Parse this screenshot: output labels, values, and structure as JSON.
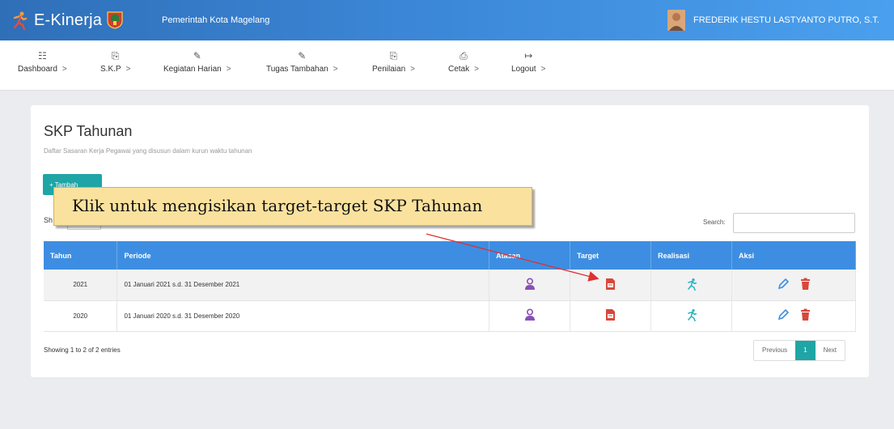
{
  "header": {
    "brand": "E-Kinerja",
    "organization": "Pemerintah Kota Magelang",
    "user_name": "FREDERIK HESTU LASTYANTO PUTRO, S.T."
  },
  "nav": [
    {
      "label": "Dashboard",
      "icon": "dashboard-icon"
    },
    {
      "label": "S.K.P",
      "icon": "file-icon"
    },
    {
      "label": "Kegiatan Harian",
      "icon": "edit-icon"
    },
    {
      "label": "Tugas Tambahan",
      "icon": "edit-icon"
    },
    {
      "label": "Penilaian",
      "icon": "file-icon"
    },
    {
      "label": "Cetak",
      "icon": "print-icon"
    },
    {
      "label": "Logout",
      "icon": "logout-icon"
    }
  ],
  "page": {
    "title": "SKP Tahunan",
    "subtitle": "Daftar Sasaran Kerja Pegawai yang disusun dalam kurun waktu tahunan",
    "add_button": "+ Tambah",
    "show_label": "Sh",
    "search_label": "Search:"
  },
  "table": {
    "headers": [
      "Tahun",
      "Periode",
      "Atasan",
      "Target",
      "Realisasi",
      "Aksi"
    ],
    "rows": [
      {
        "year": "2021",
        "period": "01 Januari 2021  s.d.  31 Desember 2021"
      },
      {
        "year": "2020",
        "period": "01 Januari 2020  s.d.  31 Desember 2020"
      }
    ]
  },
  "footer": {
    "showing": "Showing 1 to 2 of 2 entries",
    "prev": "Previous",
    "page": "1",
    "next": "Next"
  },
  "annotation": {
    "text": "Klik untuk mengisikan target-target SKP Tahunan"
  },
  "colors": {
    "header_start": "#2f6fb8",
    "header_end": "#4aa0ee",
    "table_header": "#3d8ee2",
    "primary_teal": "#1fa5a5",
    "atasan_icon": "#8a4fb5",
    "target_icon": "#d9473a",
    "realisasi_icon": "#2bb3c0",
    "edit_icon": "#3d8ee2",
    "delete_icon": "#d9473a",
    "tooltip_bg": "#fae29e",
    "arrow": "#e03030"
  }
}
